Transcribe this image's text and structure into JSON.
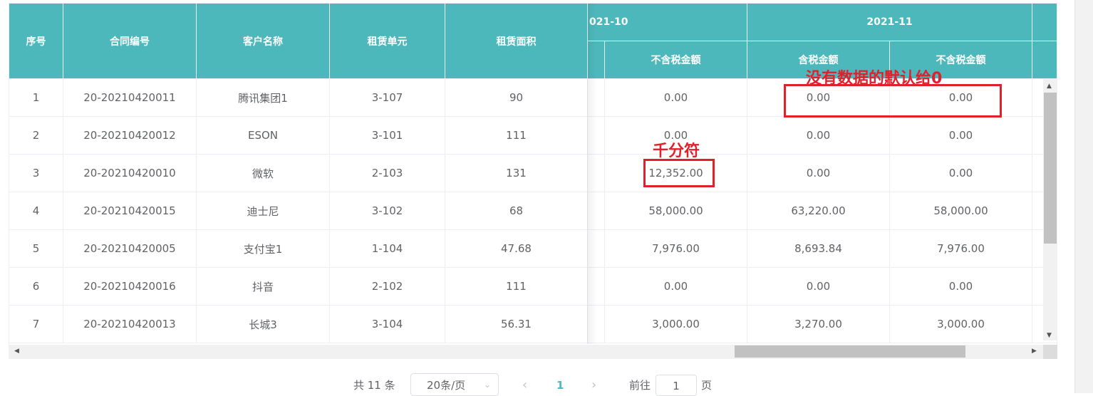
{
  "header": {
    "seq": "序号",
    "contract_no": "合同编号",
    "customer": "客户名称",
    "unit": "租赁单元",
    "area": "租赁面积",
    "month1": "021-10",
    "month2": "2021-11",
    "m1_excl_tax": "不含税金额",
    "m2_incl_tax": "含税金额",
    "m2_excl_tax": "不含税金额"
  },
  "rows": [
    {
      "seq": "1",
      "contract": "20-20210420011",
      "customer": "腾讯集团1",
      "unit": "3-107",
      "area": "90",
      "m1_excl": "0.00",
      "m2_incl": "0.00",
      "m2_excl": "0.00"
    },
    {
      "seq": "2",
      "contract": "20-20210420012",
      "customer": "ESON",
      "unit": "3-101",
      "area": "111",
      "m1_excl": "0.00",
      "m2_incl": "0.00",
      "m2_excl": "0.00"
    },
    {
      "seq": "3",
      "contract": "20-20210420010",
      "customer": "微软",
      "unit": "2-103",
      "area": "131",
      "m1_excl": "12,352.00",
      "m2_incl": "0.00",
      "m2_excl": "0.00"
    },
    {
      "seq": "4",
      "contract": "20-20210420015",
      "customer": "迪士尼",
      "unit": "3-102",
      "area": "68",
      "m1_excl": "58,000.00",
      "m2_incl": "63,220.00",
      "m2_excl": "58,000.00"
    },
    {
      "seq": "5",
      "contract": "20-20210420005",
      "customer": "支付宝1",
      "unit": "1-104",
      "area": "47.68",
      "m1_excl": "7,976.00",
      "m2_incl": "8,693.84",
      "m2_excl": "7,976.00"
    },
    {
      "seq": "6",
      "contract": "20-20210420016",
      "customer": "抖音",
      "unit": "2-102",
      "area": "111",
      "m1_excl": "0.00",
      "m2_incl": "0.00",
      "m2_excl": "0.00"
    },
    {
      "seq": "7",
      "contract": "20-20210420013",
      "customer": "长城3",
      "unit": "3-104",
      "area": "56.31",
      "m1_excl": "3,000.00",
      "m2_incl": "3,270.00",
      "m2_excl": "3,000.00"
    }
  ],
  "annotations": {
    "default_zero": "没有数据的默认给0",
    "thousands_sep": "千分符"
  },
  "pagination": {
    "total": "共 11 条",
    "page_size": "20条/页",
    "prev": "‹",
    "current": "1",
    "next": "›",
    "goto": "前往",
    "goto_value": "1",
    "page_suffix": "页"
  },
  "colors": {
    "header_bg": "#4db8bb",
    "annotation_red": "#e0202a"
  }
}
